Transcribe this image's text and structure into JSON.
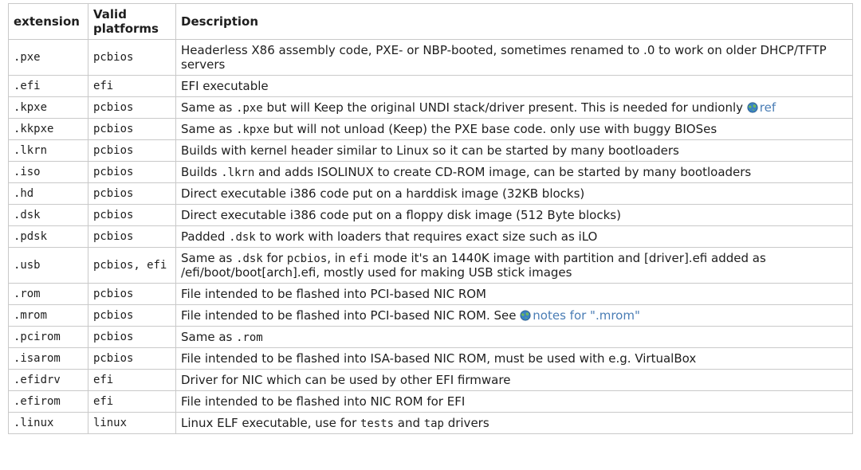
{
  "columns": [
    "extension",
    "Valid platforms",
    "Description"
  ],
  "link_icon_label": "globe-icon",
  "rows": [
    {
      "ext": ".pxe",
      "plat": "pcbios",
      "desc": [
        {
          "t": "text",
          "v": "Headerless X86 assembly code, PXE- or NBP-booted, sometimes renamed to .0 to work on older DHCP/TFTP servers"
        }
      ]
    },
    {
      "ext": ".efi",
      "plat": "efi",
      "desc": [
        {
          "t": "text",
          "v": "EFI executable"
        }
      ]
    },
    {
      "ext": ".kpxe",
      "plat": "pcbios",
      "desc": [
        {
          "t": "text",
          "v": "Same as "
        },
        {
          "t": "code",
          "v": ".pxe"
        },
        {
          "t": "text",
          "v": " but will Keep the original UNDI stack/driver present. This is needed for undionly "
        },
        {
          "t": "link",
          "v": "ref"
        }
      ]
    },
    {
      "ext": ".kkpxe",
      "plat": "pcbios",
      "desc": [
        {
          "t": "text",
          "v": "Same as "
        },
        {
          "t": "code",
          "v": ".kpxe"
        },
        {
          "t": "text",
          "v": " but will not unload (Keep) the PXE base code. only use with buggy BIOSes"
        }
      ]
    },
    {
      "ext": ".lkrn",
      "plat": "pcbios",
      "desc": [
        {
          "t": "text",
          "v": "Builds with kernel header similar to Linux so it can be started by many bootloaders"
        }
      ]
    },
    {
      "ext": ".iso",
      "plat": "pcbios",
      "desc": [
        {
          "t": "text",
          "v": "Builds "
        },
        {
          "t": "code",
          "v": ".lkrn"
        },
        {
          "t": "text",
          "v": " and adds ISOLINUX to create CD-ROM image, can be started by many bootloaders"
        }
      ]
    },
    {
      "ext": ".hd",
      "plat": "pcbios",
      "desc": [
        {
          "t": "text",
          "v": "Direct executable i386 code put on a harddisk image (32KB blocks)"
        }
      ]
    },
    {
      "ext": ".dsk",
      "plat": "pcbios",
      "desc": [
        {
          "t": "text",
          "v": "Direct executable i386 code put on a floppy disk image (512 Byte blocks)"
        }
      ]
    },
    {
      "ext": ".pdsk",
      "plat": "pcbios",
      "desc": [
        {
          "t": "text",
          "v": "Padded "
        },
        {
          "t": "code",
          "v": ".dsk"
        },
        {
          "t": "text",
          "v": " to work with loaders that requires exact size such as iLO"
        }
      ]
    },
    {
      "ext": ".usb",
      "plat": "pcbios, efi",
      "desc": [
        {
          "t": "text",
          "v": "Same as "
        },
        {
          "t": "code",
          "v": ".dsk"
        },
        {
          "t": "text",
          "v": " for "
        },
        {
          "t": "code",
          "v": "pcbios"
        },
        {
          "t": "text",
          "v": ", in "
        },
        {
          "t": "code",
          "v": "efi"
        },
        {
          "t": "text",
          "v": " mode it's an 1440K image with partition and [driver].efi added as /efi/boot/boot[arch].efi, mostly used for making USB stick images"
        }
      ]
    },
    {
      "ext": ".rom",
      "plat": "pcbios",
      "desc": [
        {
          "t": "text",
          "v": "File intended to be flashed into PCI-based NIC ROM"
        }
      ]
    },
    {
      "ext": ".mrom",
      "plat": "pcbios",
      "desc": [
        {
          "t": "text",
          "v": "File intended to be flashed into PCI-based NIC ROM. See "
        },
        {
          "t": "link",
          "v": "notes for \".mrom\""
        }
      ]
    },
    {
      "ext": ".pcirom",
      "plat": "pcbios",
      "desc": [
        {
          "t": "text",
          "v": "Same as "
        },
        {
          "t": "code",
          "v": ".rom"
        }
      ]
    },
    {
      "ext": ".isarom",
      "plat": "pcbios",
      "desc": [
        {
          "t": "text",
          "v": "File intended to be flashed into ISA-based NIC ROM, must be used with e.g. VirtualBox"
        }
      ]
    },
    {
      "ext": ".efidrv",
      "plat": "efi",
      "desc": [
        {
          "t": "text",
          "v": "Driver for NIC which can be used by other EFI firmware"
        }
      ]
    },
    {
      "ext": ".efirom",
      "plat": "efi",
      "desc": [
        {
          "t": "text",
          "v": "File intended to be flashed into NIC ROM for EFI"
        }
      ]
    },
    {
      "ext": ".linux",
      "plat": "linux",
      "desc": [
        {
          "t": "text",
          "v": "Linux ELF executable, use for "
        },
        {
          "t": "code",
          "v": "tests"
        },
        {
          "t": "text",
          "v": " and "
        },
        {
          "t": "code",
          "v": "tap"
        },
        {
          "t": "text",
          "v": " drivers"
        }
      ]
    }
  ]
}
